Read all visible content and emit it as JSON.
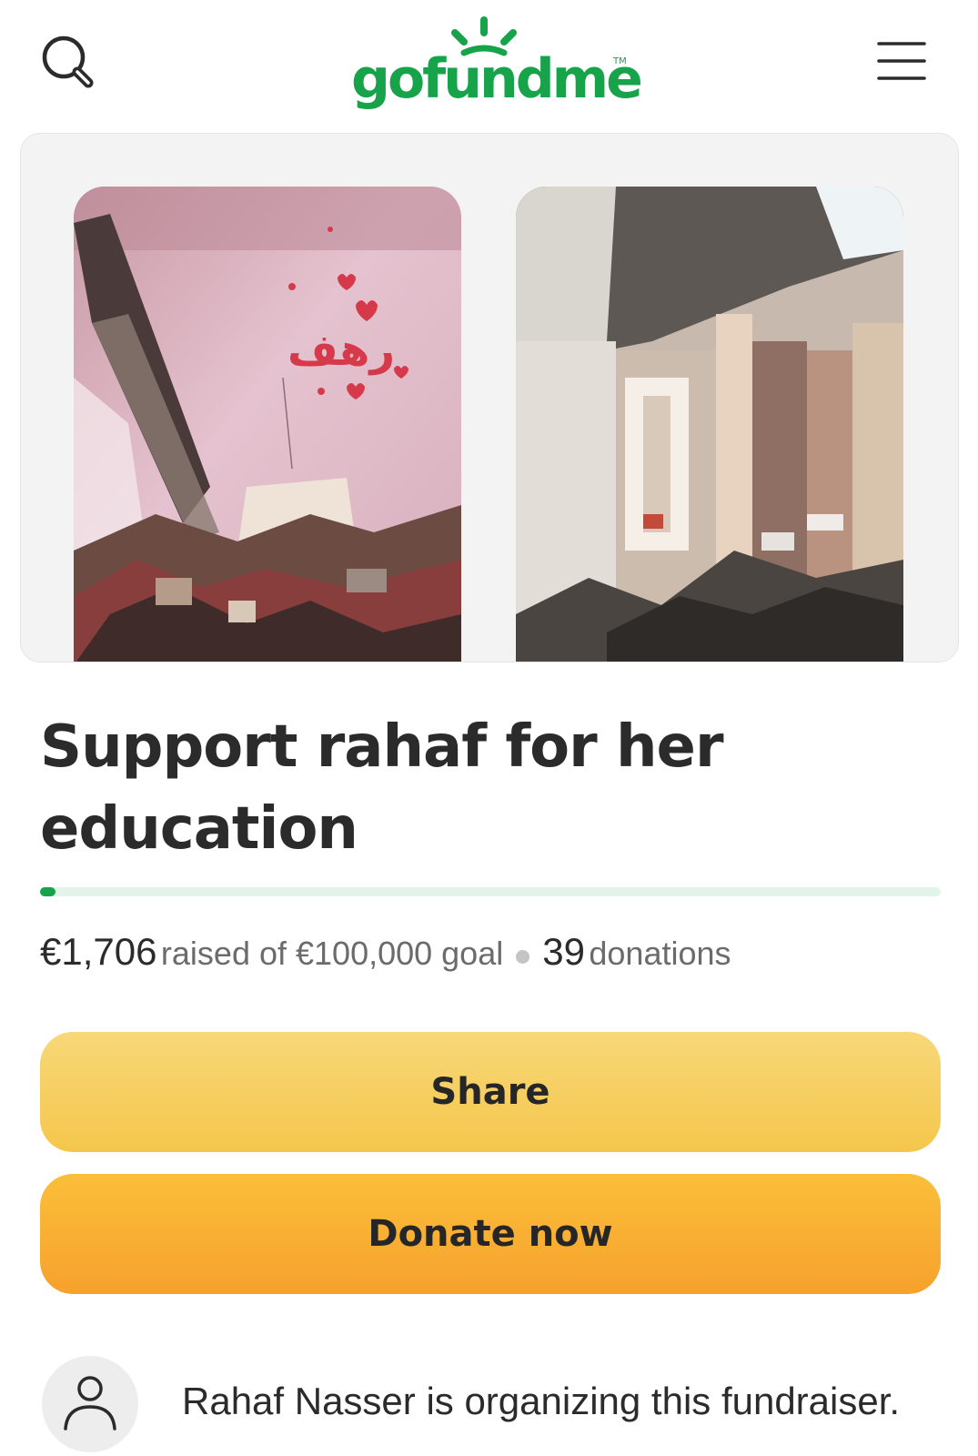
{
  "header": {
    "logo_text": "gofundme",
    "logo_tm": "TM",
    "search_icon": "search-icon",
    "menu_icon": "hamburger-menu-icon",
    "brand_color": "#17a34a"
  },
  "media": {
    "images": [
      {
        "description_icon": "damaged-pink-room-photo"
      },
      {
        "description_icon": "destroyed-hallway-photo"
      }
    ],
    "graffiti_text": "رهف"
  },
  "campaign": {
    "title": "Support rahaf for her education",
    "progress_fraction": 0.017,
    "raised_amount": "€1,706",
    "raised_text": "raised of €100,000 goal",
    "donation_count": "39",
    "donation_label": "donations"
  },
  "actions": {
    "share_label": "Share",
    "donate_label": "Donate now",
    "share_color": "#f5c64c",
    "donate_color": "#f6a12c"
  },
  "organizer": {
    "avatar_icon": "person-icon",
    "text": "Rahaf Nasser is organizing this fundraiser."
  }
}
